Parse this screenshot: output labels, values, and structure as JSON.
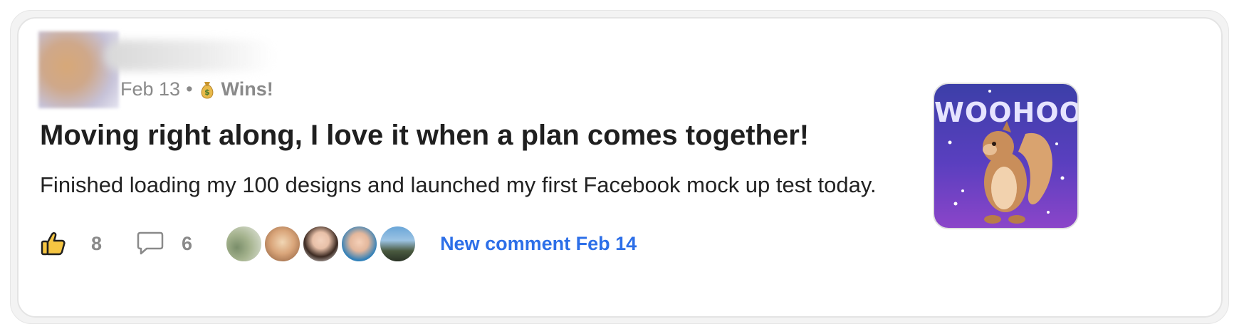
{
  "post": {
    "date": "Feb 13",
    "separator": "•",
    "category": "Wins!",
    "category_icon": "money-bag-icon",
    "title": "Moving right along, I love it when a plan comes together!",
    "body": "Finished loading my 100 designs and launched my first Facebook mock up test today."
  },
  "actions": {
    "like_icon": "thumbs-up-icon",
    "like_count": "8",
    "comment_icon": "comment-bubble-icon",
    "comment_count": "6",
    "new_comment_label": "New comment Feb 14"
  },
  "commenters": [
    "commenter-1",
    "commenter-2",
    "commenter-3",
    "commenter-4",
    "commenter-5"
  ],
  "media": {
    "gif_text": "WOOHOO"
  },
  "colors": {
    "accent_link": "#2d6fe8",
    "muted_text": "#8a8a8a",
    "title_text": "#1f1f1f",
    "thumb_fill": "#f5c542"
  }
}
